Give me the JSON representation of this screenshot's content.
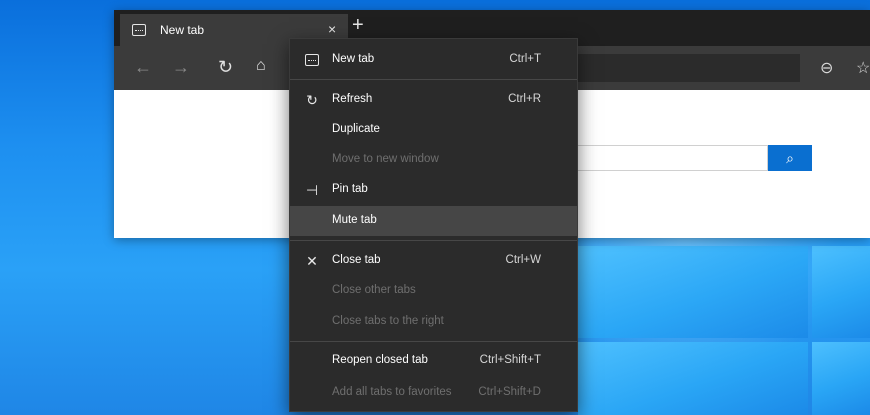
{
  "browser": {
    "tab": {
      "title": "New tab",
      "close_glyph": "×"
    },
    "new_tab_glyph": "+",
    "toolbar": {
      "back": "←",
      "forward": "→",
      "refresh": "↻",
      "home": "⌂",
      "zoom": "⊖",
      "favorite": "☆"
    },
    "search_button_glyph": "⌕"
  },
  "menu": {
    "items": [
      {
        "label": "New tab",
        "shortcut": "Ctrl+T",
        "icon": "tab-icon",
        "enabled": true
      },
      {
        "label": "Refresh",
        "shortcut": "Ctrl+R",
        "icon": "refresh-icon",
        "enabled": true
      },
      {
        "label": "Duplicate",
        "shortcut": "",
        "icon": "",
        "enabled": true
      },
      {
        "label": "Move to new window",
        "shortcut": "",
        "icon": "",
        "enabled": false
      },
      {
        "label": "Pin tab",
        "shortcut": "",
        "icon": "pin-icon",
        "enabled": true
      },
      {
        "label": "Mute tab",
        "shortcut": "",
        "icon": "",
        "enabled": true,
        "highlighted": true
      },
      {
        "label": "Close tab",
        "shortcut": "Ctrl+W",
        "icon": "close-icon",
        "enabled": true
      },
      {
        "label": "Close other tabs",
        "shortcut": "",
        "icon": "",
        "enabled": false
      },
      {
        "label": "Close tabs to the right",
        "shortcut": "",
        "icon": "",
        "enabled": false
      },
      {
        "label": "Reopen closed tab",
        "shortcut": "Ctrl+Shift+T",
        "icon": "",
        "enabled": true
      },
      {
        "label": "Add all tabs to favorites",
        "shortcut": "Ctrl+Shift+D",
        "icon": "",
        "enabled": false
      }
    ]
  },
  "colors": {
    "accent": "#0a6fd0",
    "menu_bg": "#2b2b2b",
    "menu_hover": "#464646",
    "tab_bg": "#3b3b3b"
  }
}
